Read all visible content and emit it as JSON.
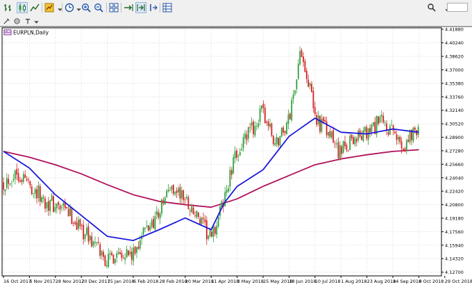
{
  "toolbar": {
    "icons": [
      "bar-chart-icon",
      "candlestick-chart-icon",
      "line-chart-icon",
      "indicators-icon",
      "periods-icon",
      "zoom-in-icon",
      "zoom-out-icon",
      "tile-windows-icon",
      "auto-scroll-icon",
      "chart-shift-icon",
      "templates-icon"
    ],
    "right_icons": [
      "search-icon"
    ]
  },
  "toolbar2": {
    "icons": [
      "crosshair-tool-icon",
      "circle-tool-icon",
      "text-tool-icon"
    ]
  },
  "chart": {
    "symbol_label": "EURPLN,Daily",
    "colors": {
      "bull": "#2e9f3a",
      "bear": "#d42020",
      "ma_fast": "#1a1adb",
      "ma_slow": "#b0105a",
      "grid": "#d8d8d8"
    }
  },
  "chart_data": {
    "type": "candlestick",
    "symbol": "EURPLN",
    "timeframe": "Daily",
    "x_ticks": [
      "16 Oct 2017",
      "6 Nov 2017",
      "28 Nov 2017",
      "20 Dec 2017",
      "15 Jan 2018",
      "6 Feb 2018",
      "28 Feb 2018",
      "20 Mar 2018",
      "11 Apr 2018",
      "3 May 2018",
      "25 May 2018",
      "18 Jun 2018",
      "10 Jul 2018",
      "1 Aug 2018",
      "23 Aug 2018",
      "14 Sep 2018",
      "8 Oct 2018",
      "29 Oct 2018"
    ],
    "y_ticks": [
      "4.41880",
      "4.40240",
      "4.38620",
      "4.37000",
      "4.35380",
      "4.33760",
      "4.32140",
      "4.30520",
      "4.28900",
      "4.27280",
      "4.25660",
      "4.24040",
      "4.22420",
      "4.20800",
      "4.19180",
      "4.17560",
      "4.15940",
      "4.14320",
      "4.12700"
    ],
    "ylim": [
      4.1225,
      4.4205
    ],
    "series_points": {
      "price_path": [
        [
          "16 Oct 2017",
          4.235
        ],
        [
          "27 Oct 2017",
          4.248
        ],
        [
          "6 Nov 2017",
          4.233
        ],
        [
          "17 Nov 2017",
          4.215
        ],
        [
          "28 Nov 2017",
          4.206
        ],
        [
          "9 Dec 2017",
          4.198
        ],
        [
          "20 Dec 2017",
          4.18
        ],
        [
          "2 Jan 2018",
          4.16
        ],
        [
          "15 Jan 2018",
          4.14
        ],
        [
          "26 Jan 2018",
          4.155
        ],
        [
          "6 Feb 2018",
          4.145
        ],
        [
          "12 Feb 2018",
          4.17
        ],
        [
          "20 Feb 2018",
          4.183
        ],
        [
          "28 Feb 2018",
          4.2
        ],
        [
          "9 Mar 2018",
          4.23
        ],
        [
          "20 Mar 2018",
          4.215
        ],
        [
          "30 Mar 2018",
          4.193
        ],
        [
          "11 Apr 2018",
          4.165
        ],
        [
          "20 Apr 2018",
          4.205
        ],
        [
          "3 May 2018",
          4.272
        ],
        [
          "14 May 2018",
          4.295
        ],
        [
          "25 May 2018",
          4.32
        ],
        [
          "5 Jun 2018",
          4.28
        ],
        [
          "18 Jun 2018",
          4.31
        ],
        [
          "25 Jun 2018",
          4.37
        ],
        [
          "29 Jun 2018",
          4.395
        ],
        [
          "10 Jul 2018",
          4.315
        ],
        [
          "20 Jul 2018",
          4.295
        ],
        [
          "1 Aug 2018",
          4.27
        ],
        [
          "10 Aug 2018",
          4.288
        ],
        [
          "23 Aug 2018",
          4.292
        ],
        [
          "3 Sep 2018",
          4.308
        ],
        [
          "14 Sep 2018",
          4.292
        ],
        [
          "24 Sep 2018",
          4.28
        ],
        [
          "8 Oct 2018",
          4.305
        ]
      ],
      "ma_fast_path": [
        [
          "16 Oct 2017",
          4.272
        ],
        [
          "6 Nov 2017",
          4.252
        ],
        [
          "28 Nov 2017",
          4.22
        ],
        [
          "20 Dec 2017",
          4.195
        ],
        [
          "15 Jan 2018",
          4.17
        ],
        [
          "6 Feb 2018",
          4.165
        ],
        [
          "28 Feb 2018",
          4.178
        ],
        [
          "20 Mar 2018",
          4.192
        ],
        [
          "11 Apr 2018",
          4.178
        ],
        [
          "22 Apr 2018",
          4.21
        ],
        [
          "3 May 2018",
          4.23
        ],
        [
          "25 May 2018",
          4.25
        ],
        [
          "18 Jun 2018",
          4.29
        ],
        [
          "10 Jul 2018",
          4.312
        ],
        [
          "1 Aug 2018",
          4.295
        ],
        [
          "23 Aug 2018",
          4.293
        ],
        [
          "14 Sep 2018",
          4.299
        ],
        [
          "8 Oct 2018",
          4.295
        ]
      ],
      "ma_slow_path": [
        [
          "16 Oct 2017",
          4.272
        ],
        [
          "6 Nov 2017",
          4.265
        ],
        [
          "28 Nov 2017",
          4.256
        ],
        [
          "20 Dec 2017",
          4.245
        ],
        [
          "15 Jan 2018",
          4.232
        ],
        [
          "6 Feb 2018",
          4.22
        ],
        [
          "28 Feb 2018",
          4.212
        ],
        [
          "20 Mar 2018",
          4.208
        ],
        [
          "11 Apr 2018",
          4.205
        ],
        [
          "3 May 2018",
          4.215
        ],
        [
          "25 May 2018",
          4.23
        ],
        [
          "18 Jun 2018",
          4.243
        ],
        [
          "10 Jul 2018",
          4.256
        ],
        [
          "1 Aug 2018",
          4.263
        ],
        [
          "23 Aug 2018",
          4.268
        ],
        [
          "14 Sep 2018",
          4.272
        ],
        [
          "8 Oct 2018",
          4.274
        ]
      ]
    }
  }
}
